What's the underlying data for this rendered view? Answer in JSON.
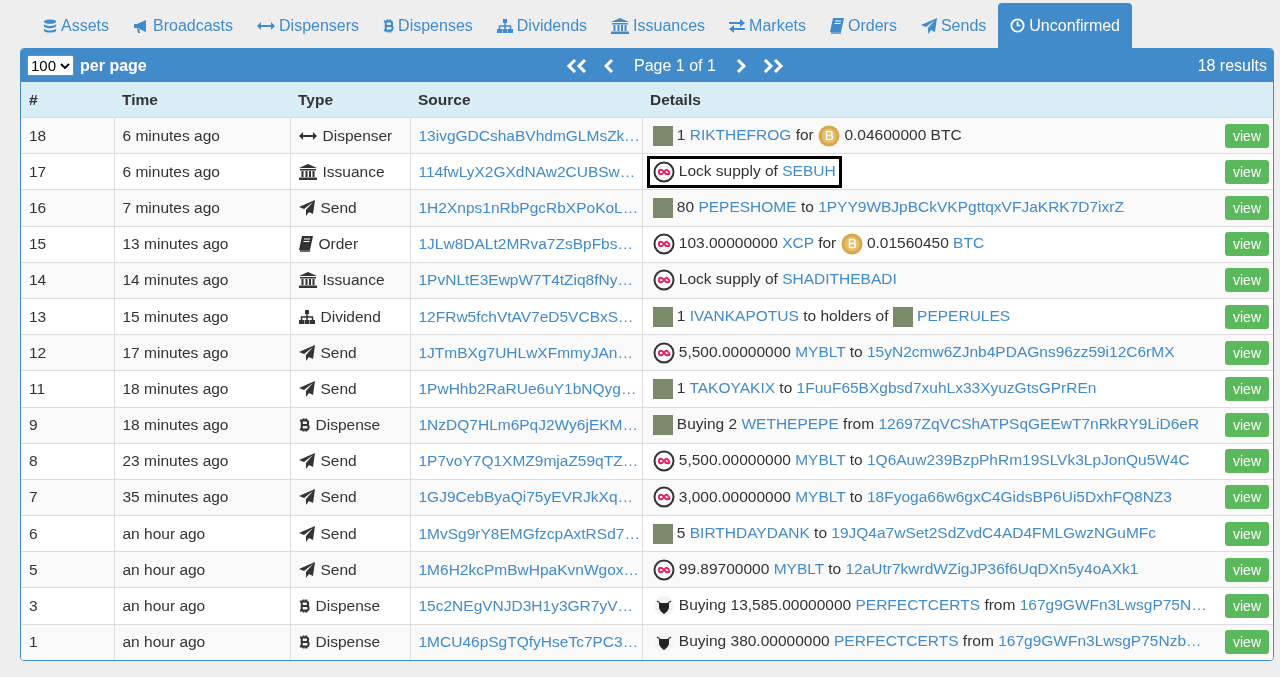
{
  "tabs": [
    {
      "kind": "database",
      "label": "Assets",
      "selected": false
    },
    {
      "kind": "bullhorn",
      "label": "Broadcasts",
      "selected": false
    },
    {
      "kind": "arrows",
      "label": "Dispensers",
      "selected": false
    },
    {
      "kind": "bitcoin",
      "label": "Dispenses",
      "selected": false
    },
    {
      "kind": "sitemap",
      "label": "Dividends",
      "selected": false
    },
    {
      "kind": "bank",
      "label": "Issuances",
      "selected": false
    },
    {
      "kind": "exchange",
      "label": "Markets",
      "selected": false
    },
    {
      "kind": "book",
      "label": "Orders",
      "selected": false
    },
    {
      "kind": "plane",
      "label": "Sends",
      "selected": false
    },
    {
      "kind": "clock",
      "label": "Unconfirmed",
      "selected": true
    }
  ],
  "toolbar": {
    "page_size": "100",
    "page_size_label": "per page",
    "page_label": "Page 1 of 1",
    "results": "18 results"
  },
  "columns": [
    "#",
    "Time",
    "Type",
    "Details"
  ],
  "source_column": "Source",
  "rows": [
    {
      "number": "18",
      "time": "6 minutes ago",
      "type": {
        "kind": "arrows",
        "label": "Dispenser"
      },
      "source": "13ivgGDCshaBVhdmGLMsZk…",
      "highlighted": false,
      "details": [
        {
          "kind": "thumb"
        },
        {
          "kind": "text",
          "text": "1"
        },
        {
          "kind": "link",
          "text": "RIKTHEFROG"
        },
        {
          "kind": "text",
          "text": "for"
        },
        {
          "kind": "coin"
        },
        {
          "kind": "text",
          "text": "0.04600000 BTC"
        }
      ],
      "action": "view"
    },
    {
      "number": "17",
      "time": "6 minutes ago",
      "type": {
        "kind": "bank",
        "label": "Issuance"
      },
      "source": "114fwLyX2GXdNAw2CUBSw…",
      "highlighted": true,
      "details": [
        {
          "kind": "token"
        },
        {
          "kind": "text",
          "text": "Lock supply of"
        },
        {
          "kind": "link",
          "text": "SEBUH"
        }
      ],
      "action": "view"
    },
    {
      "number": "16",
      "time": "7 minutes ago",
      "type": {
        "kind": "plane",
        "label": "Send"
      },
      "source": "1H2Xnps1nRbPgcRbXPoKoL…",
      "highlighted": false,
      "details": [
        {
          "kind": "thumb"
        },
        {
          "kind": "text",
          "text": "80"
        },
        {
          "kind": "link",
          "text": "PEPESHOME"
        },
        {
          "kind": "text",
          "text": "to"
        },
        {
          "kind": "link",
          "text": "1PYY9WBJpBCkVKPgttqxVFJaKRK7D7ixrZ"
        }
      ],
      "action": "view"
    },
    {
      "number": "15",
      "time": "13 minutes ago",
      "type": {
        "kind": "book",
        "label": "Order"
      },
      "source": "1JLw8DALt2MRva7ZsBpFbs…",
      "highlighted": false,
      "details": [
        {
          "kind": "token"
        },
        {
          "kind": "text",
          "text": "103.00000000"
        },
        {
          "kind": "link",
          "text": "XCP"
        },
        {
          "kind": "text",
          "text": "for"
        },
        {
          "kind": "coin"
        },
        {
          "kind": "text",
          "text": "0.01560450"
        },
        {
          "kind": "link",
          "text": "BTC"
        }
      ],
      "action": "view"
    },
    {
      "number": "14",
      "time": "14 minutes ago",
      "type": {
        "kind": "bank",
        "label": "Issuance"
      },
      "source": "1PvNLtE3EwpW7T4tZiq8fNy…",
      "highlighted": false,
      "details": [
        {
          "kind": "token"
        },
        {
          "kind": "text",
          "text": "Lock supply of"
        },
        {
          "kind": "link",
          "text": "SHADITHEBADI"
        }
      ],
      "action": "view"
    },
    {
      "number": "13",
      "time": "15 minutes ago",
      "type": {
        "kind": "sitemap",
        "label": "Dividend"
      },
      "source": "12FRw5fchVtAV7eD5VCBxS…",
      "highlighted": false,
      "details": [
        {
          "kind": "thumb"
        },
        {
          "kind": "text",
          "text": "1"
        },
        {
          "kind": "link",
          "text": "IVANKAPOTUS"
        },
        {
          "kind": "text",
          "text": "to holders of"
        },
        {
          "kind": "thumb"
        },
        {
          "kind": "link",
          "text": "PEPERULES"
        }
      ],
      "action": "view"
    },
    {
      "number": "12",
      "time": "17 minutes ago",
      "type": {
        "kind": "plane",
        "label": "Send"
      },
      "source": "1JTmBXg7UHLwXFmmyJAn…",
      "highlighted": false,
      "details": [
        {
          "kind": "token"
        },
        {
          "kind": "text",
          "text": "5,500.00000000"
        },
        {
          "kind": "link",
          "text": "MYBLT"
        },
        {
          "kind": "text",
          "text": "to"
        },
        {
          "kind": "link",
          "text": "15yN2cmw6ZJnb4PDAGns96zz59i12C6rMX"
        }
      ],
      "action": "view"
    },
    {
      "number": "11",
      "time": "18 minutes ago",
      "type": {
        "kind": "plane",
        "label": "Send"
      },
      "source": "1PwHhb2RaRUe6uY1bNQyg…",
      "highlighted": false,
      "details": [
        {
          "kind": "thumb"
        },
        {
          "kind": "text",
          "text": "1"
        },
        {
          "kind": "link",
          "text": "TAKOYAKIX"
        },
        {
          "kind": "text",
          "text": "to"
        },
        {
          "kind": "link",
          "text": "1FuuF65BXgbsd7xuhLx33XyuzGtsGPrREn"
        }
      ],
      "action": "view"
    },
    {
      "number": "9",
      "time": "18 minutes ago",
      "type": {
        "kind": "bitcoin",
        "label": "Dispense"
      },
      "source": "1NzDQ7HLm6PqJ2Wy6jEKM…",
      "highlighted": false,
      "details": [
        {
          "kind": "thumb"
        },
        {
          "kind": "text",
          "text": "Buying 2"
        },
        {
          "kind": "link",
          "text": "WETHEPEPE"
        },
        {
          "kind": "text",
          "text": "from"
        },
        {
          "kind": "link",
          "text": "12697ZqVCShATPSqGEEwT7nRkRY9LiD6eR"
        }
      ],
      "action": "view"
    },
    {
      "number": "8",
      "time": "23 minutes ago",
      "type": {
        "kind": "plane",
        "label": "Send"
      },
      "source": "1P7voY7Q1XMZ9mjaZ59qTZ…",
      "highlighted": false,
      "details": [
        {
          "kind": "token"
        },
        {
          "kind": "text",
          "text": "5,500.00000000"
        },
        {
          "kind": "link",
          "text": "MYBLT"
        },
        {
          "kind": "text",
          "text": "to"
        },
        {
          "kind": "link",
          "text": "1Q6Auw239BzpPhRm19SLVk3LpJonQu5W4C"
        }
      ],
      "action": "view"
    },
    {
      "number": "7",
      "time": "35 minutes ago",
      "type": {
        "kind": "plane",
        "label": "Send"
      },
      "source": "1GJ9CebByaQi75yEVRJkXq…",
      "highlighted": false,
      "details": [
        {
          "kind": "token"
        },
        {
          "kind": "text",
          "text": "3,000.00000000"
        },
        {
          "kind": "link",
          "text": "MYBLT"
        },
        {
          "kind": "text",
          "text": "to"
        },
        {
          "kind": "link",
          "text": "18Fyoga66w6gxC4GidsBP6Ui5DxhFQ8NZ3"
        }
      ],
      "action": "view"
    },
    {
      "number": "6",
      "time": "an hour ago",
      "type": {
        "kind": "plane",
        "label": "Send"
      },
      "source": "1MvSg9rY8EMGfzcpAxtRSd7…",
      "highlighted": false,
      "details": [
        {
          "kind": "thumb"
        },
        {
          "kind": "text",
          "text": "5"
        },
        {
          "kind": "link",
          "text": "BIRTHDAYDANK"
        },
        {
          "kind": "text",
          "text": "to"
        },
        {
          "kind": "link",
          "text": "19JQ4a7wSet2SdZvdC4AD4FMLGwzNGuMFc"
        }
      ],
      "action": "view"
    },
    {
      "number": "5",
      "time": "an hour ago",
      "type": {
        "kind": "plane",
        "label": "Send"
      },
      "source": "1M6H2kcPmBwHpaKvnWgox…",
      "highlighted": false,
      "details": [
        {
          "kind": "token"
        },
        {
          "kind": "text",
          "text": "99.89700000"
        },
        {
          "kind": "link",
          "text": "MYBLT"
        },
        {
          "kind": "text",
          "text": "to"
        },
        {
          "kind": "link",
          "text": "12aUtr7kwrdWZigJP36f6UqDXn5y4oAXk1"
        }
      ],
      "action": "view"
    },
    {
      "number": "3",
      "time": "an hour ago",
      "type": {
        "kind": "bitcoin",
        "label": "Dispense"
      },
      "source": "15c2NEgVNJD3H1y3GR7yV…",
      "highlighted": false,
      "details": [
        {
          "kind": "emblem"
        },
        {
          "kind": "text",
          "text": "Buying 13,585.00000000"
        },
        {
          "kind": "link",
          "text": "PERFECTCERTS"
        },
        {
          "kind": "text",
          "text": "from"
        },
        {
          "kind": "link",
          "text": "167g9GWFn3LwsgP75N…"
        }
      ],
      "action": "view"
    },
    {
      "number": "1",
      "time": "an hour ago",
      "type": {
        "kind": "bitcoin",
        "label": "Dispense"
      },
      "source": "1MCU46pSgTQfyHseTc7PC3…",
      "highlighted": false,
      "details": [
        {
          "kind": "emblem"
        },
        {
          "kind": "text",
          "text": "Buying 380.00000000"
        },
        {
          "kind": "link",
          "text": "PERFECTCERTS"
        },
        {
          "kind": "text",
          "text": "from"
        },
        {
          "kind": "link",
          "text": "167g9GWFn3LwsgP75Nzb…"
        }
      ],
      "action": "view"
    }
  ]
}
